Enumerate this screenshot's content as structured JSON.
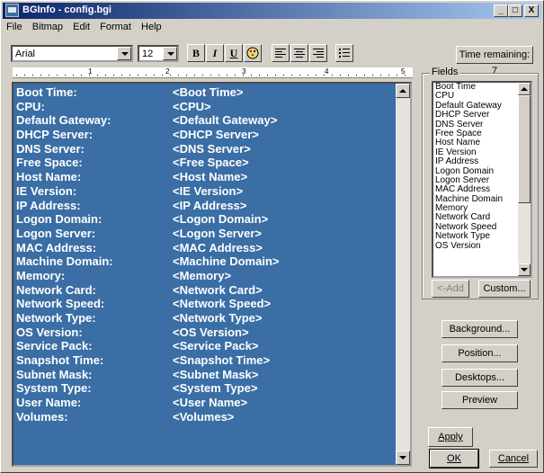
{
  "window": {
    "title": "BGInfo - config.bgi"
  },
  "titlebar_buttons": {
    "minimize": "_",
    "maximize": "□",
    "close": "X"
  },
  "menu": [
    {
      "label": "File"
    },
    {
      "label": "Bitmap"
    },
    {
      "label": "Edit"
    },
    {
      "label": "Format"
    },
    {
      "label": "Help"
    }
  ],
  "toolbar": {
    "font_value": "Arial",
    "size_value": "12",
    "bold_label": "B",
    "italic_label": "I",
    "underline_label": "U",
    "time_remaining_label": "Time remaining: 7"
  },
  "ruler": {
    "numbers": [
      "1",
      "2",
      "3",
      "4",
      "5"
    ]
  },
  "editor": {
    "rows": [
      {
        "label": "Boot Time:",
        "value": "<Boot Time>"
      },
      {
        "label": "CPU:",
        "value": "<CPU>"
      },
      {
        "label": "Default Gateway:",
        "value": "<Default Gateway>"
      },
      {
        "label": "DHCP Server:",
        "value": "<DHCP Server>"
      },
      {
        "label": "DNS Server:",
        "value": "<DNS Server>"
      },
      {
        "label": "Free Space:",
        "value": "<Free Space>"
      },
      {
        "label": "Host Name:",
        "value": "<Host Name>"
      },
      {
        "label": "IE Version:",
        "value": "<IE Version>"
      },
      {
        "label": "IP Address:",
        "value": "<IP Address>"
      },
      {
        "label": "Logon Domain:",
        "value": "<Logon Domain>"
      },
      {
        "label": "Logon Server:",
        "value": "<Logon Server>"
      },
      {
        "label": "MAC Address:",
        "value": "<MAC Address>"
      },
      {
        "label": "Machine Domain:",
        "value": "<Machine Domain>"
      },
      {
        "label": "Memory:",
        "value": "<Memory>"
      },
      {
        "label": "Network Card:",
        "value": "<Network Card>"
      },
      {
        "label": "Network Speed:",
        "value": "<Network Speed>"
      },
      {
        "label": "Network Type:",
        "value": "<Network Type>"
      },
      {
        "label": "OS Version:",
        "value": "<OS Version>"
      },
      {
        "label": "Service Pack:",
        "value": "<Service Pack>"
      },
      {
        "label": "Snapshot Time:",
        "value": "<Snapshot Time>"
      },
      {
        "label": "Subnet Mask:",
        "value": "<Subnet Mask>"
      },
      {
        "label": "System Type:",
        "value": "<System Type>"
      },
      {
        "label": "User Name:",
        "value": "<User Name>"
      },
      {
        "label": "Volumes:",
        "value": "<Volumes>"
      }
    ]
  },
  "fields": {
    "legend": "Fields",
    "items": [
      "Boot Time",
      "CPU",
      "Default Gateway",
      "DHCP Server",
      "DNS Server",
      "Free Space",
      "Host Name",
      "IE Version",
      "IP Address",
      "Logon Domain",
      "Logon Server",
      "MAC Address",
      "Machine Domain",
      "Memory",
      "Network Card",
      "Network Speed",
      "Network Type",
      "OS Version"
    ],
    "add_label": "<-Add",
    "custom_label": "Custom..."
  },
  "buttons": {
    "background": "Background...",
    "position": "Position...",
    "desktops": "Desktops...",
    "preview": "Preview",
    "apply": "Apply",
    "ok": "OK",
    "cancel": "Cancel"
  },
  "colors": {
    "selection": "#3a6ea5",
    "titlebar": "#0a246a",
    "face": "#d4d0c8"
  }
}
